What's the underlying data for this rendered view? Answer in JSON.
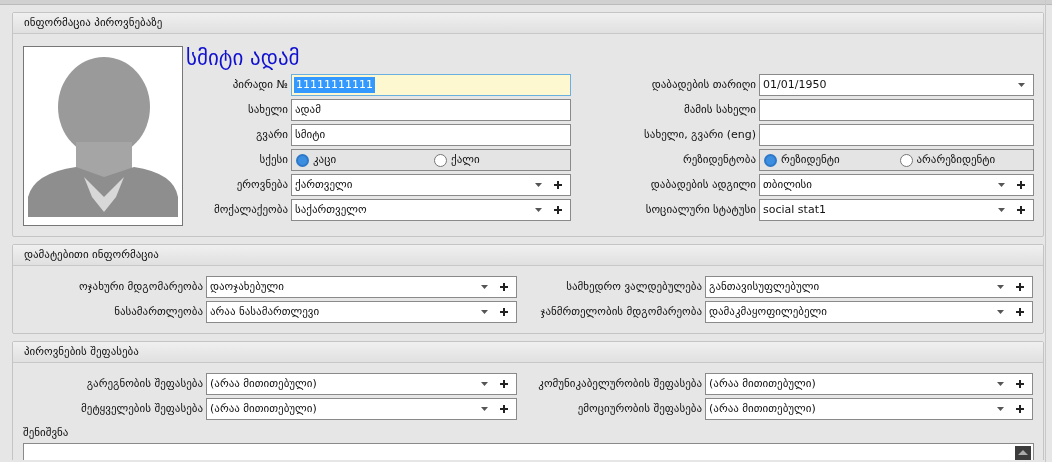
{
  "sections": [
    {
      "title": "ინფორმაცია პიროვნებაზე",
      "person_name": "სმიტი ადამ",
      "left_fields": [
        {
          "kind": "text",
          "label": "პირადი №",
          "value": "11111111111",
          "focused": true
        },
        {
          "kind": "text",
          "label": "სახელი",
          "value": "ადამ",
          "focused": false
        },
        {
          "kind": "text",
          "label": "გვარი",
          "value": "სმიტი",
          "focused": false
        },
        {
          "kind": "radio",
          "label": "სქესი",
          "options": [
            {
              "label": "კაცი",
              "selected": true
            },
            {
              "label": "ქალი",
              "selected": false
            }
          ]
        },
        {
          "kind": "combo",
          "label": "ეროვნება",
          "value": "ქართველი"
        },
        {
          "kind": "combo",
          "label": "მოქალაქეობა",
          "value": "საქართველო"
        }
      ],
      "right_fields": [
        {
          "kind": "date",
          "label": "დაბადების თარიღი",
          "value": "01/01/1950"
        },
        {
          "kind": "text",
          "label": "მამის სახელი",
          "focused": false
        },
        {
          "kind": "text",
          "label": "სახელი, გვარი (eng)",
          "focused": false
        },
        {
          "kind": "radio",
          "label": "რეზიდენტობა",
          "options": [
            {
              "label": "რეზიდენტი",
              "selected": true
            },
            {
              "label": "არარეზიდენტი",
              "selected": false
            }
          ]
        },
        {
          "kind": "combo",
          "label": "დაბადების ადგილი",
          "value": "თბილისი"
        },
        {
          "kind": "combo",
          "label": "სოციალური სტატუსი",
          "value": "social stat1"
        }
      ]
    },
    {
      "title": "დამატებითი ინფორმაცია",
      "left_fields": [
        {
          "kind": "combo",
          "label": "ოჯახური მდგომარეობა",
          "value": "დაოჯახებული"
        },
        {
          "kind": "combo",
          "label": "ნასამართლეობა",
          "value": "არაა ნასამართლევი"
        }
      ],
      "right_fields": [
        {
          "kind": "combo",
          "label": "სამხედრო ვალდებულება",
          "value": "განთავისუფლებული"
        },
        {
          "kind": "combo",
          "label": "ჯანმრთელობის მდგომარეობა",
          "value": "დამაკმაყოფილებელი"
        }
      ]
    },
    {
      "title": "პიროვნების შეფასება",
      "left_fields": [
        {
          "kind": "combo",
          "label": "გარეგნობის შეფასება",
          "value": "(არაა მითითებული)"
        },
        {
          "kind": "combo",
          "label": "მეტყველების შეფასება",
          "value": "(არაა მითითებული)"
        }
      ],
      "right_fields": [
        {
          "kind": "combo",
          "label": "კომუნიკაბელურობის შეფასება",
          "value": "(არაა მითითებული)"
        },
        {
          "kind": "combo",
          "label": "ემოციურობის შეფასება",
          "value": "(არაა მითითებული)"
        }
      ],
      "note": {
        "label": "შენიშვნა"
      }
    }
  ]
}
